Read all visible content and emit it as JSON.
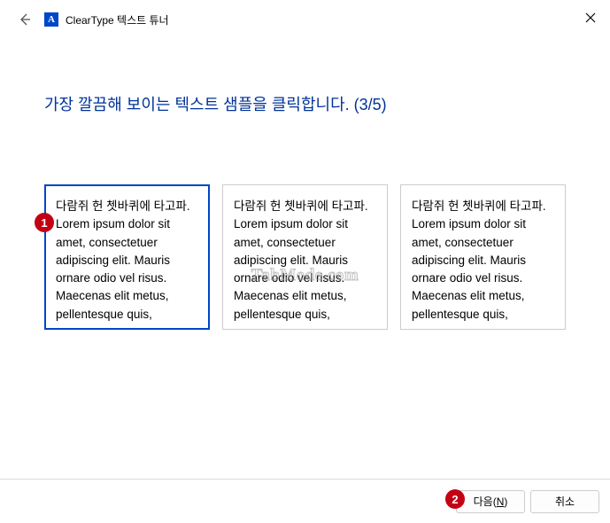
{
  "titlebar": {
    "app_title": "ClearType 텍스트 튜너",
    "app_icon_letter": "A"
  },
  "heading": "가장 깔끔해 보이는 텍스트 샘플을 클릭합니다. (3/5)",
  "samples": [
    {
      "text": "다람쥐 헌 쳇바퀴에 타고파. Lorem ipsum dolor sit amet, consectetuer adipiscing elit. Mauris ornare odio vel risus. Maecenas elit metus, pellentesque quis,",
      "selected": true
    },
    {
      "text": "다람쥐 헌 쳇바퀴에 타고파. Lorem ipsum dolor sit amet, consectetuer adipiscing elit. Mauris ornare odio vel risus. Maecenas elit metus, pellentesque quis,",
      "selected": false
    },
    {
      "text": "다람쥐 헌 쳇바퀴에 타고파. Lorem ipsum dolor sit amet, consectetuer adipiscing elit. Mauris ornare odio vel risus. Maecenas elit metus, pellentesque quis,",
      "selected": false
    }
  ],
  "footer": {
    "next_label": "다음(N)",
    "cancel_label": "취소"
  },
  "badges": {
    "one": "1",
    "two": "2"
  },
  "watermark": "TabMode.com"
}
